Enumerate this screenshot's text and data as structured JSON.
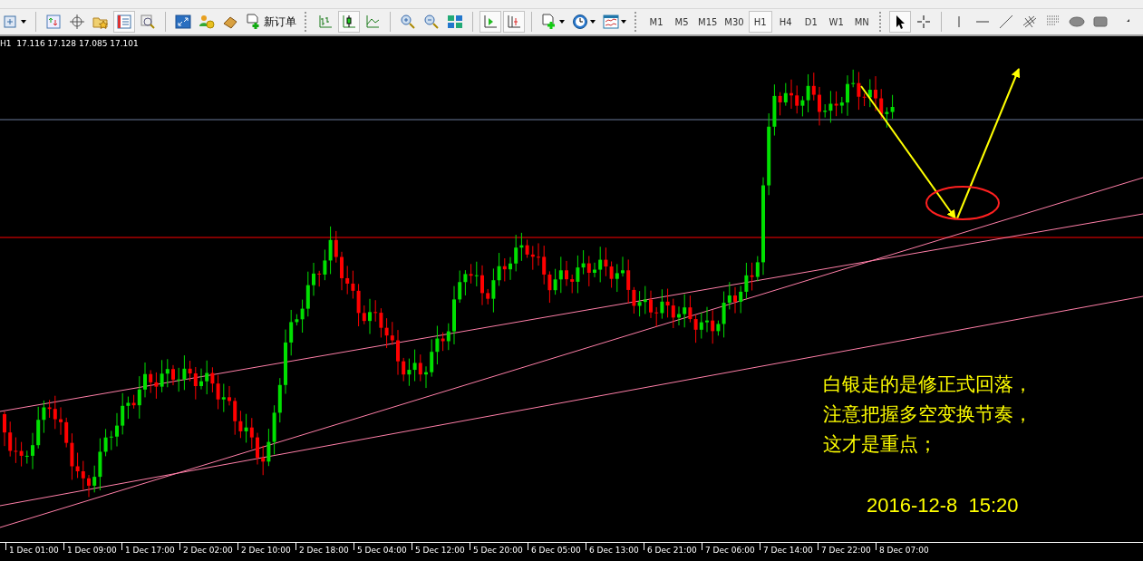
{
  "toolbar": {
    "new_order_label": "新订单",
    "chart_types": [
      {
        "selected": false
      },
      {
        "selected": true
      },
      {
        "selected": false
      }
    ],
    "timeframes": [
      {
        "label": "M1",
        "selected": false
      },
      {
        "label": "M5",
        "selected": false
      },
      {
        "label": "M15",
        "selected": false
      },
      {
        "label": "M30",
        "selected": false
      },
      {
        "label": "H1",
        "selected": true
      },
      {
        "label": "H4",
        "selected": false
      },
      {
        "label": "D1",
        "selected": false
      },
      {
        "label": "W1",
        "selected": false
      },
      {
        "label": "MN",
        "selected": false
      }
    ]
  },
  "chart": {
    "header": "H1  17.116 17.128 17.085 17.101",
    "note_lines": [
      "白银走的是修正式回落，",
      "注意把握多空变换节奏，",
      "这才是重点；"
    ],
    "timestamp": "2016-12-8  15:20",
    "time_labels": [
      "1 Dec 01:00",
      "1 Dec 09:00",
      "1 Dec 17:00",
      "2 Dec 02:00",
      "2 Dec 10:00",
      "2 Dec 18:00",
      "5 Dec 04:00",
      "5 Dec 12:00",
      "5 Dec 20:00",
      "6 Dec 05:00",
      "6 Dec 13:00",
      "6 Dec 21:00",
      "7 Dec 06:00",
      "7 Dec 14:00",
      "7 Dec 22:00",
      "8 Dec 07:00"
    ]
  }
}
